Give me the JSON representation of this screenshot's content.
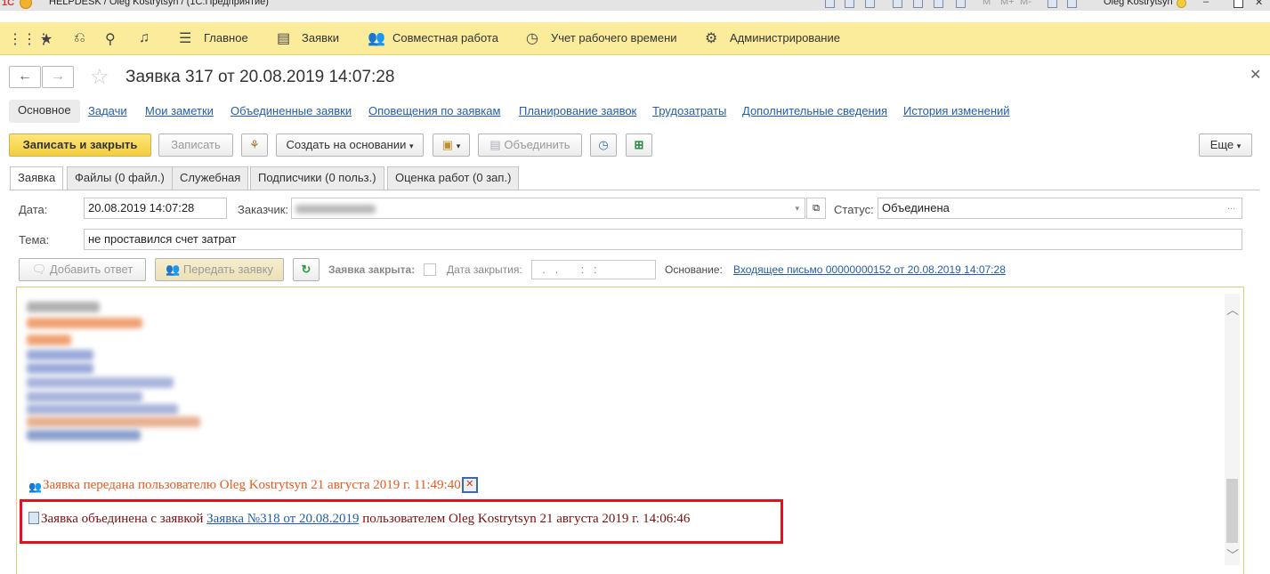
{
  "window": {
    "title": "HELPDESK / Oleg Kostrytsyn /  (1С:Предприятие)",
    "user": "Oleg Kostrytsyn"
  },
  "menu": {
    "items": [
      "Главное",
      "Заявки",
      "Совместная работа",
      "Учет рабочего времени",
      "Администрирование"
    ]
  },
  "page": {
    "title": "Заявка 317 от 20.08.2019 14:07:28"
  },
  "sections": {
    "active": "Основное",
    "links": [
      "Задачи",
      "Мои заметки",
      "Объединенные заявки",
      "Оповещения по заявкам",
      "Планирование заявок",
      "Трудозатраты",
      "Дополнительные сведения",
      "История изменений"
    ]
  },
  "toolbar": {
    "save_close": "Записать и закрыть",
    "save": "Записать",
    "create_based": "Создать на основании",
    "merge": "Объединить",
    "more": "Еще"
  },
  "form_tabs": [
    "Заявка",
    "Файлы (0 файл.)",
    "Служебная",
    "Подписчики (0 польз.)",
    "Оценка работ (0 зап.)"
  ],
  "form": {
    "date_label": "Дата:",
    "date_value": "20.08.2019 14:07:28",
    "customer_label": "Заказчик:",
    "status_label": "Статус:",
    "status_value": "Объединена",
    "topic_label": "Тема:",
    "topic_value": "не проставился счет затрат",
    "add_answer": "Добавить ответ",
    "transfer": "Передать заявку",
    "closed_label": "Заявка закрыта:",
    "close_date_label": "Дата закрытия:",
    "close_date_value": "  .   .       :   :",
    "basis_label": "Основание:",
    "basis_link": "Входящее письмо 00000000152 от 20.08.2019 14:07:28"
  },
  "history": {
    "msg1": "Заявка передана пользователю Oleg Kostrytsyn 21 августа 2019 г. 11:49:40",
    "msg2_prefix": "Заявка объединена с заявкой ",
    "msg2_link": "Заявка №318 от 20.08.2019",
    "msg2_suffix": " пользователем Oleg Kostrytsyn 21 августа 2019 г. 14:06:46"
  },
  "colors": {
    "menu_bg": "#fbec9c",
    "accent_button": "#f4cd3d",
    "link": "#245ea8",
    "highlight_box": "#e8101c",
    "msg_orange": "#e85a1e",
    "msg_dark_red": "#7a1010"
  }
}
